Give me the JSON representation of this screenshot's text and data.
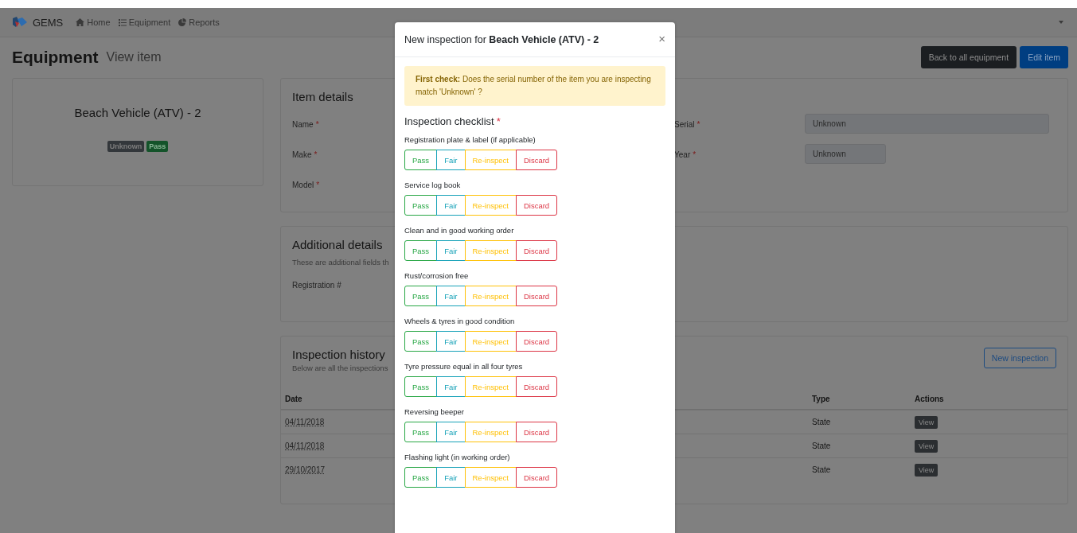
{
  "navbar": {
    "brand": "GEMS",
    "links": [
      {
        "label": "Home"
      },
      {
        "label": "Equipment"
      },
      {
        "label": "Reports"
      }
    ]
  },
  "page_header": {
    "title": "Equipment",
    "subtitle": "View item",
    "buttons": [
      {
        "label": "Back to all equipment",
        "kind": "dark"
      },
      {
        "label": "Edit item",
        "kind": "primary"
      }
    ]
  },
  "item_card": {
    "title": "Beach Vehicle (ATV) - 2",
    "badges": [
      {
        "label": "Unknown",
        "kind": "secondary"
      },
      {
        "label": "Pass",
        "kind": "success"
      }
    ]
  },
  "item_details": {
    "title": "Item details",
    "fields": [
      {
        "label": "Name",
        "marker": "*"
      },
      {
        "label": "Serial",
        "marker": "*",
        "value": "Unknown"
      },
      {
        "label": "Make",
        "marker": "*"
      },
      {
        "label": "Year",
        "marker": "*",
        "value": "Unknown"
      },
      {
        "label": "Model",
        "marker": "*"
      }
    ]
  },
  "additional_details": {
    "title": "Additional details",
    "description": "These are additional fields th",
    "fields": [
      {
        "label": "Registration #"
      }
    ]
  },
  "inspection_history": {
    "title": "Inspection history",
    "description": "Below are all the inspections",
    "button": "New inspection",
    "columns": [
      {
        "label": "Date"
      },
      {
        "label": "Type"
      },
      {
        "label": "Actions"
      }
    ],
    "rows": [
      {
        "date": "04/11/2018",
        "type": "State",
        "action": "View"
      },
      {
        "date": "04/11/2018",
        "type": "State",
        "action": "View"
      },
      {
        "date": "29/10/2017",
        "type": "State",
        "action": "View"
      }
    ]
  },
  "modal": {
    "title": "New inspection for **Beach Vehicle (ATV) - 2**",
    "close": "×",
    "alert": "**First check:** Does the serial number of the item you are inspecting match 'Unknown' ?",
    "checklist_title": "Inspection checklist",
    "checklist_marker": "*",
    "items": [
      {
        "label": "Registration plate & label (if applicable)",
        "options": [
          {
            "label": "Pass",
            "kind": "success",
            "selected": false
          },
          {
            "label": "Fair",
            "kind": "info",
            "selected": false
          },
          {
            "label": "Re-inspect",
            "kind": "warning",
            "selected": false
          },
          {
            "label": "Discard",
            "kind": "danger",
            "selected": false
          }
        ]
      },
      {
        "label": "Service log book",
        "options": [
          {
            "label": "Pass",
            "kind": "success",
            "selected": false
          },
          {
            "label": "Fair",
            "kind": "info",
            "selected": false
          },
          {
            "label": "Re-inspect",
            "kind": "warning",
            "selected": false
          },
          {
            "label": "Discard",
            "kind": "danger",
            "selected": false
          }
        ]
      },
      {
        "label": "Clean and in good working order",
        "options": [
          {
            "label": "Pass",
            "kind": "success",
            "selected": false
          },
          {
            "label": "Fair",
            "kind": "info",
            "selected": false
          },
          {
            "label": "Re-inspect",
            "kind": "warning",
            "selected": false
          },
          {
            "label": "Discard",
            "kind": "danger",
            "selected": false
          }
        ]
      },
      {
        "label": "Rust/corrosion free",
        "options": [
          {
            "label": "Pass",
            "kind": "success",
            "selected": false
          },
          {
            "label": "Fair",
            "kind": "info",
            "selected": false
          },
          {
            "label": "Re-inspect",
            "kind": "warning",
            "selected": false
          },
          {
            "label": "Discard",
            "kind": "danger",
            "selected": false
          }
        ]
      },
      {
        "label": "Wheels & tyres in good condition",
        "options": [
          {
            "label": "Pass",
            "kind": "success",
            "selected": false
          },
          {
            "label": "Fair",
            "kind": "info",
            "selected": false
          },
          {
            "label": "Re-inspect",
            "kind": "warning",
            "selected": false
          },
          {
            "label": "Discard",
            "kind": "danger",
            "selected": false
          }
        ]
      },
      {
        "label": "Tyre pressure equal in all four tyres",
        "options": [
          {
            "label": "Pass",
            "kind": "success",
            "selected": false
          },
          {
            "label": "Fair",
            "kind": "info",
            "selected": false
          },
          {
            "label": "Re-inspect",
            "kind": "warning",
            "selected": false
          },
          {
            "label": "Discard",
            "kind": "danger",
            "selected": false
          }
        ]
      },
      {
        "label": "Reversing beeper",
        "options": [
          {
            "label": "Pass",
            "kind": "success",
            "selected": false
          },
          {
            "label": "Fair",
            "kind": "info",
            "selected": false
          },
          {
            "label": "Re-inspect",
            "kind": "warning",
            "selected": false
          },
          {
            "label": "Discard",
            "kind": "danger",
            "selected": false
          }
        ]
      },
      {
        "label": "Flashing light (in working order)",
        "options": [
          {
            "label": "Pass",
            "kind": "success",
            "selected": false
          },
          {
            "label": "Fair",
            "kind": "info",
            "selected": false
          },
          {
            "label": "Re-inspect",
            "kind": "warning",
            "selected": false
          },
          {
            "label": "Discard",
            "kind": "danger",
            "selected": false
          }
        ]
      }
    ]
  }
}
